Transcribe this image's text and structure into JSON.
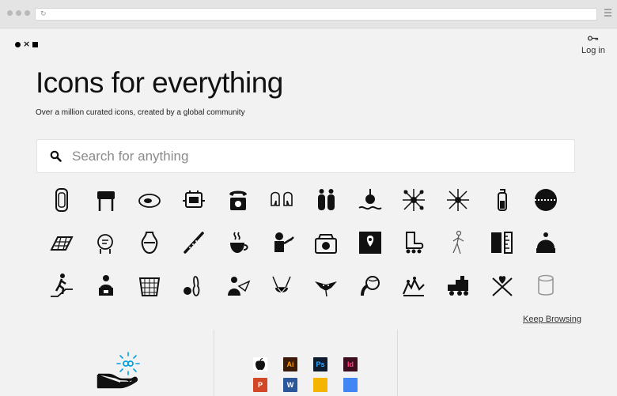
{
  "header": {
    "login_label": "Log in"
  },
  "hero": {
    "title": "Icons for everything",
    "subtitle": "Over a million curated icons, created by a global community"
  },
  "search": {
    "placeholder": "Search for anything"
  },
  "icons": [
    "gem-icon",
    "bbq-grill-icon",
    "oyster-icon",
    "robot-icon",
    "telephone-icon",
    "elephants-icon",
    "salt-pepper-icon",
    "fishing-float-icon",
    "molecule-icon",
    "network-icon",
    "test-tube-icon",
    "cricket-ball-icon",
    "solar-panel-icon",
    "thinking-head-icon",
    "amphora-icon",
    "flute-icon",
    "coffee-cup-icon",
    "mechanic-icon",
    "cash-register-icon",
    "map-pin-icon",
    "roller-skate-icon",
    "walking-figure-icon",
    "book-ruler-icon",
    "beanie-icon",
    "escalator-person-icon",
    "laptop-user-icon",
    "laundry-basket-icon",
    "bowling-icon",
    "paper-plane-person-icon",
    "bra-icon",
    "manta-ray-icon",
    "globe-head-icon",
    "soldiers-icon",
    "train-icon",
    "crossed-heart-icon",
    "cylinder-icon"
  ],
  "keep_browsing": "Keep Browsing",
  "apps": [
    {
      "name": "apple-icon",
      "label": "",
      "bg": "#ffffff",
      "fg": "#111111"
    },
    {
      "name": "illustrator-icon",
      "label": "Ai",
      "bg": "#3b1a0a",
      "fg": "#ff9a00"
    },
    {
      "name": "photoshop-icon",
      "label": "Ps",
      "bg": "#0e1c2f",
      "fg": "#31a8ff"
    },
    {
      "name": "indesign-icon",
      "label": "Id",
      "bg": "#3d0e1f",
      "fg": "#ff3e7f"
    },
    {
      "name": "blank-icon",
      "label": "",
      "bg": "transparent",
      "fg": "#111111"
    },
    {
      "name": "powerpoint-icon",
      "label": "P",
      "bg": "#d24726",
      "fg": "#ffffff"
    },
    {
      "name": "word-icon",
      "label": "W",
      "bg": "#2b579a",
      "fg": "#ffffff"
    },
    {
      "name": "google-slides-icon",
      "label": "",
      "bg": "#f4b400",
      "fg": "#ffffff"
    },
    {
      "name": "google-docs-icon",
      "label": "",
      "bg": "#4285f4",
      "fg": "#ffffff"
    }
  ],
  "colors": {
    "background": "#f2f2f2",
    "accent": "#00a3e0",
    "text": "#111111"
  }
}
